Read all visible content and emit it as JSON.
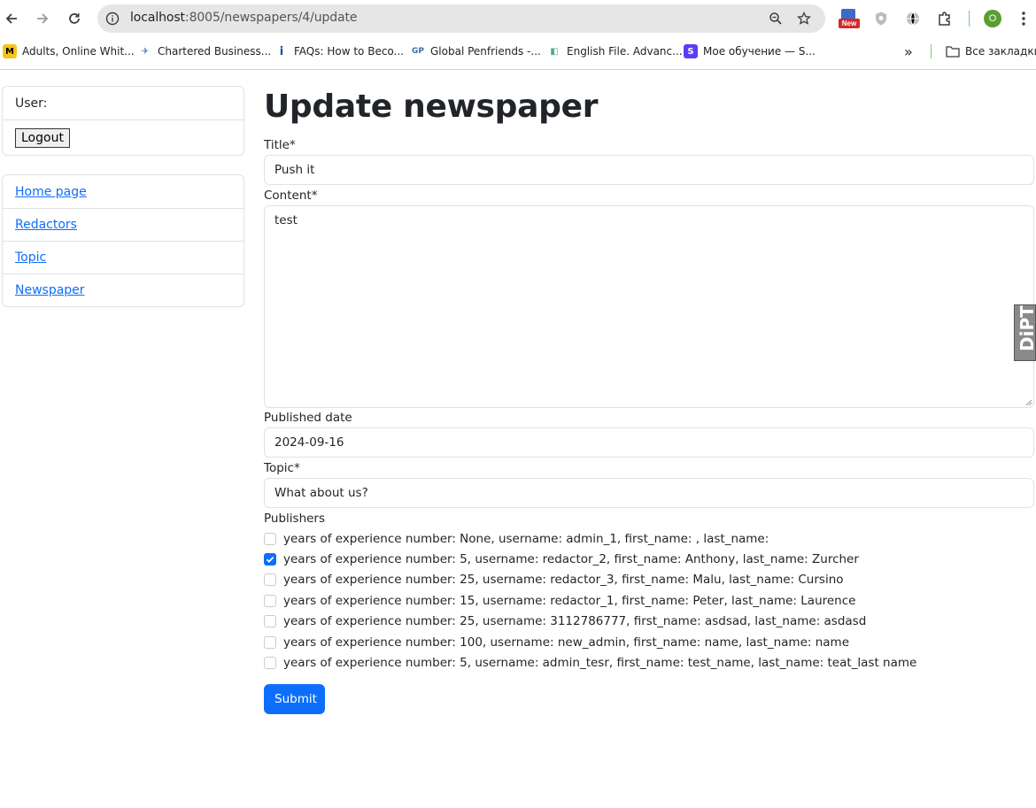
{
  "browser": {
    "url_host": "localhost",
    "url_rest": ":8005/newspapers/4/update",
    "extension_badge": "New",
    "profile_initial": "O",
    "bookmarks": [
      {
        "label": "Adults, Online Whit...",
        "icon": "m-favicon",
        "color": "#f5c518",
        "glyph": "M"
      },
      {
        "label": "Chartered Business...",
        "icon": "plane-favicon",
        "color": "#4a6fa5",
        "glyph": "✈"
      },
      {
        "label": "FAQs: How to Beco...",
        "icon": "info-favicon",
        "color": "#1a4fa0",
        "glyph": "i"
      },
      {
        "label": "Global Penfriends -...",
        "icon": "gp-favicon",
        "color": "#3a6ea5",
        "glyph": "GP"
      },
      {
        "label": "English File. Advanc...",
        "icon": "book-favicon",
        "color": "#4caf82",
        "glyph": "◧"
      },
      {
        "label": "Мое обучение — S...",
        "icon": "s-favicon",
        "color": "#5b3df5",
        "glyph": "S"
      }
    ],
    "more_label": "»",
    "all_bookmarks": "Все закладки"
  },
  "sidebar": {
    "user_label": "User:",
    "logout_label": "Logout",
    "nav": [
      {
        "label": "Home page"
      },
      {
        "label": "Redactors"
      },
      {
        "label": "Topic"
      },
      {
        "label": "Newspaper"
      }
    ]
  },
  "form": {
    "heading": "Update newspaper",
    "title_label": "Title*",
    "title_value": "Push it",
    "content_label": "Content*",
    "content_value": "test",
    "date_label": "Published date",
    "date_value": "2024-09-16",
    "topic_label": "Topic*",
    "topic_value": "What about us?",
    "publishers_label": "Publishers",
    "publishers": [
      {
        "label": "years of experience number: None, username: admin_1, first_name: , last_name:",
        "checked": false
      },
      {
        "label": "years of experience number: 5, username: redactor_2, first_name: Anthony, last_name: Zurcher",
        "checked": true
      },
      {
        "label": "years of experience number: 25, username: redactor_3, first_name: Malu, last_name: Cursino",
        "checked": false
      },
      {
        "label": "years of experience number: 15, username: redactor_1, first_name: Peter, last_name: Laurence",
        "checked": false
      },
      {
        "label": "years of experience number: 25, username: 3112786777, first_name: asdsad, last_name: asdasd",
        "checked": false
      },
      {
        "label": "years of experience number: 100, username: new_admin, first_name: name, last_name: name",
        "checked": false
      },
      {
        "label": "years of experience number: 5, username: admin_tesr, first_name: test_name, last_name: teat_last name",
        "checked": false
      }
    ],
    "submit_label": "Submit"
  },
  "side_widget": {
    "label": "DiPT"
  },
  "colors": {
    "accent": "#0d6efd",
    "border": "#dee2e6"
  }
}
